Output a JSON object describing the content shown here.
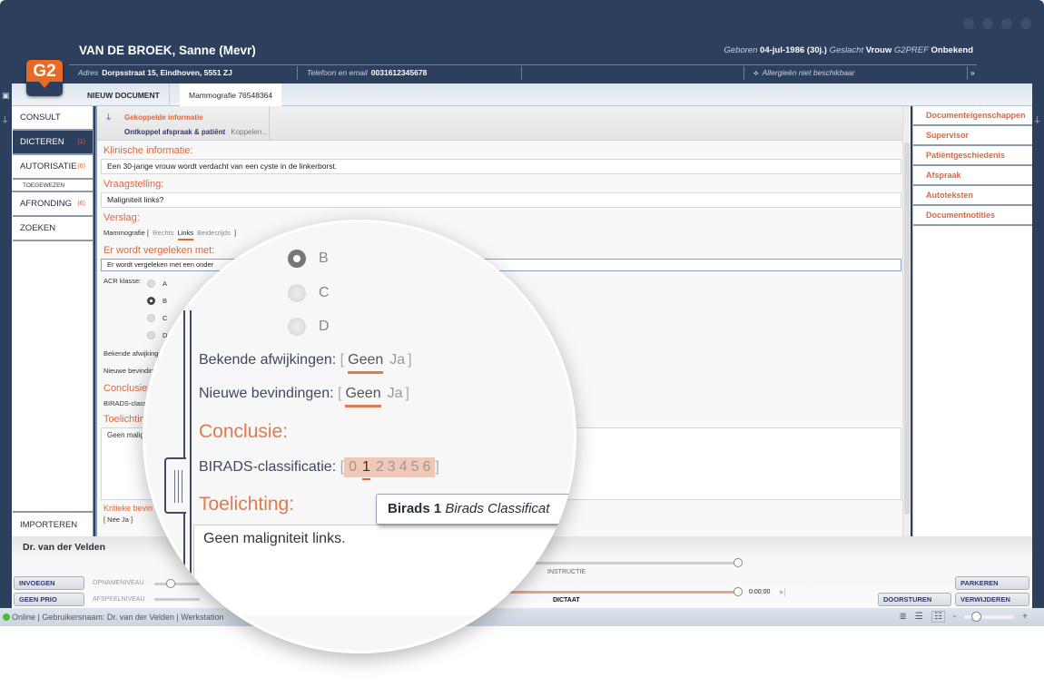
{
  "patient": {
    "name": "VAN DE BROEK, Sanne (Mevr)",
    "born_label": "Geboren",
    "born_value": "04-jul-1986 (30j.)",
    "gender_label": "Geslacht",
    "gender_value": "Vrouw",
    "pref_label": "G2PREF",
    "pref_value": "Onbekend",
    "address_label": "Adres",
    "address_value": "Dorpsstraat 15, Eindhoven, 5551 ZJ",
    "phone_label": "Telefoon en email",
    "phone_value": "0031612345678",
    "allergies": "Allergieën niet beschikbaar"
  },
  "logo": "G2",
  "tabs": [
    {
      "label": "NIEUW DOCUMENT"
    },
    {
      "label": "Mammografie 76548364",
      "active": true
    }
  ],
  "leftnav": {
    "items": [
      {
        "label": "CONSULT",
        "count": ""
      },
      {
        "label": "DICTEREN",
        "count": "(1)",
        "active": true
      },
      {
        "label": "AUTORISATIE",
        "count": "(6)"
      },
      {
        "label": "TOEGEWEZEN",
        "sub": true
      },
      {
        "label": "AFRONDING",
        "count": "(6)"
      },
      {
        "label": "ZOEKEN",
        "count": ""
      }
    ],
    "bottom_item": "IMPORTEREN"
  },
  "linked_info": {
    "title": "Gekoppelde informatie",
    "unlink": "Ontkoppel afspraak & patiënt",
    "link": "Koppelen..."
  },
  "form": {
    "clinical_title": "Klinische informatie:",
    "clinical_value": "Een 30-jarige vrouw wordt verdacht van een cyste in de linkerborst.",
    "question_title": "Vraagstelling:",
    "question_value": "Maligniteit links?",
    "report_title": "Verslag:",
    "report_type": "Mammografie",
    "side_options": [
      "Rechts",
      "Links",
      "Beiderzijds"
    ],
    "side_selected": "Links",
    "compare_title": "Er wordt vergeleken met:",
    "compare_value": "Er wordt vergeleken met een onder",
    "acr_label": "ACR klasse:",
    "acr_options": [
      "A",
      "B",
      "C",
      "D"
    ],
    "acr_selected": "B",
    "known_label": "Bekende afwijkingen:",
    "new_label": "Nieuwe bevindingen:",
    "yesno_options": [
      "Geen",
      "Ja"
    ],
    "known_selected": "Geen",
    "new_selected": "Geen",
    "conclusion_title": "Conclusie:",
    "birads_label": "BIRADS-classificatie:",
    "birads_options": [
      "0",
      "1",
      "2",
      "3",
      "4",
      "5",
      "6"
    ],
    "birads_selected": "1",
    "explanation_title": "Toelichting:",
    "explanation_value": "Geen maligniteit links.",
    "critical_title": "Kritieke bevin",
    "critical_options": "[ Nee  Ja ]"
  },
  "tooltip": {
    "bold": "Birads 1",
    "italic": "Birads Classificat"
  },
  "rightpanel": {
    "items": [
      "Documenteigenschappen",
      "Supervisor",
      "Patiëntgeschiedenis",
      "Afspraak",
      "Autoteksten",
      "Documentnotities"
    ]
  },
  "bottom": {
    "doctor": "Dr. van der Velden",
    "insert_btn": "INVOEGEN",
    "prio_btn": "GEEN PRIO",
    "record_level": "OPNAMENIVEAU",
    "play_level": "AFSPEELNIVEAU",
    "instruction_label": "INSTRUCTIE",
    "dictation_label": "DICTAAT",
    "time": "0:00:00",
    "park_btn": "PARKEREN",
    "forward_btn": "DOORSTUREN",
    "delete_btn": "VERWIJDEREN"
  },
  "status": {
    "text": "Online | Gebruikersnaam: Dr. van der Velden | Werkstation",
    "zoom_minus": "-",
    "zoom_plus": "+"
  }
}
